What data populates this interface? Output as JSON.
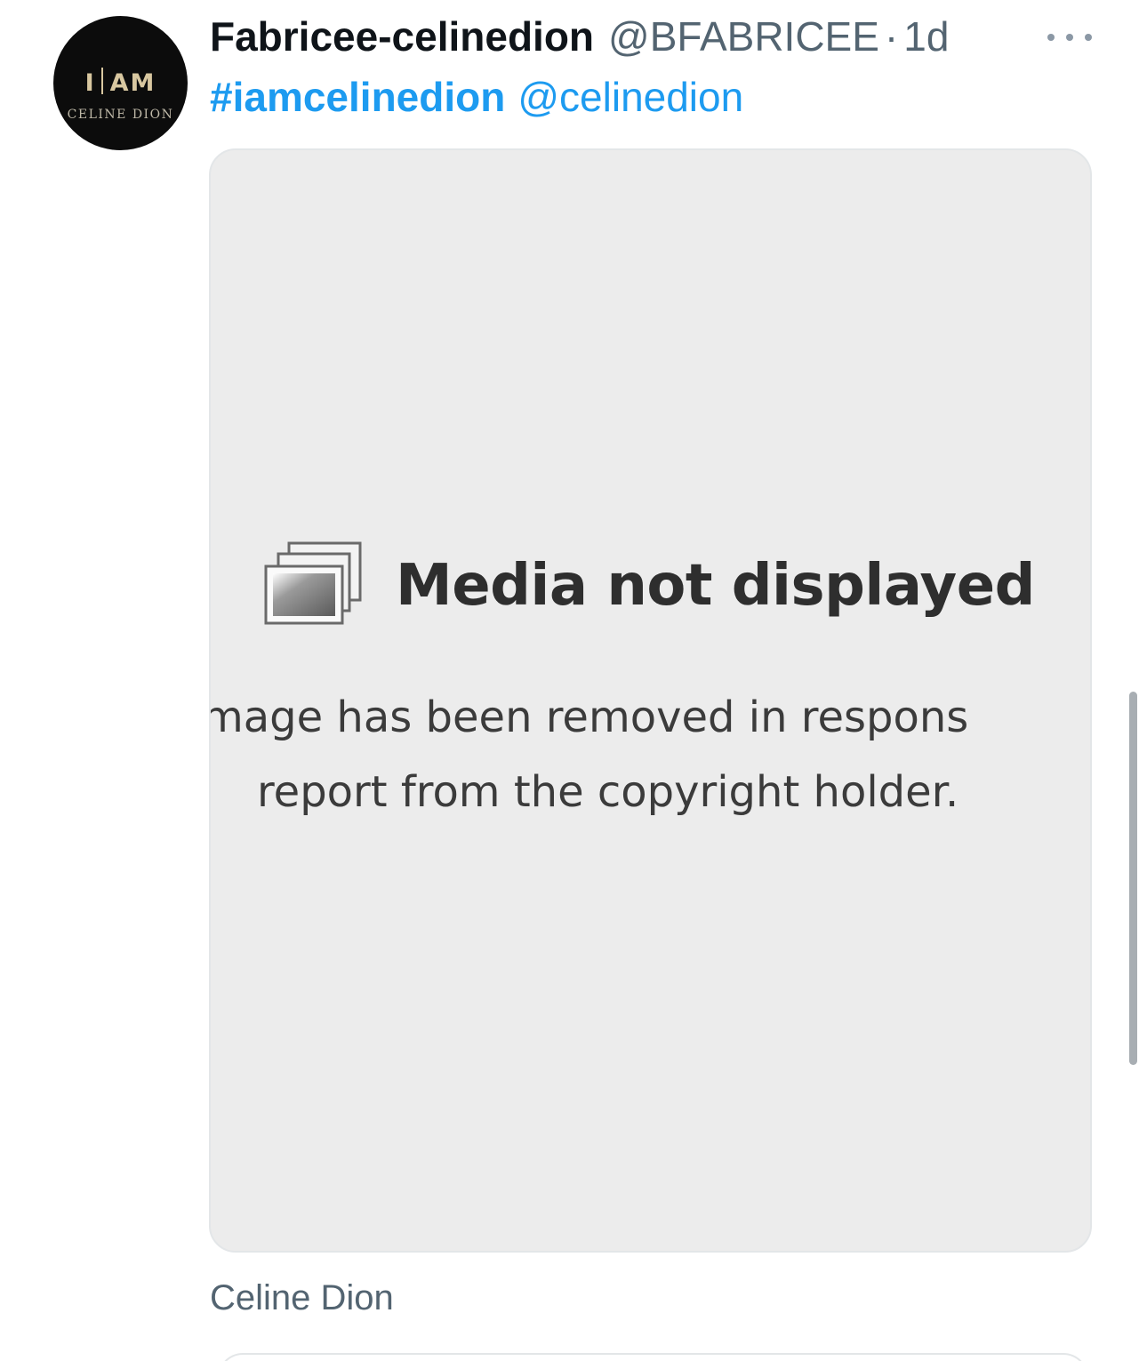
{
  "tweet": {
    "display_name": "Fabricee-celinedion",
    "handle": "@BFABRICEE",
    "separator": "·",
    "time": "1d",
    "hashtag": "#iamcelinedion",
    "mention": "@celinedion",
    "avatar": {
      "line1_left": "I",
      "line1_right": "AM",
      "line2": "CELINE DION"
    },
    "more_icon": "more-horizontal-icon"
  },
  "media": {
    "icon": "image-placeholder-icon",
    "title": "Media not displayed",
    "message_line1": "mage has been removed in respons",
    "message_line2": "report from the copyright holder."
  },
  "card": {
    "source_label": "Celine Dion"
  },
  "colors": {
    "link": "#1d9bf0",
    "secondary_text": "#536471",
    "primary_text": "#0f1419",
    "media_bg": "#ececec"
  }
}
